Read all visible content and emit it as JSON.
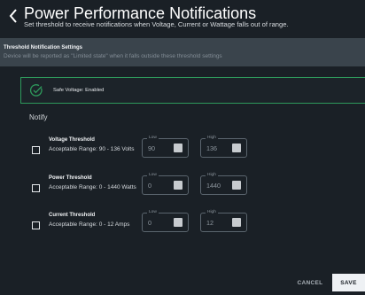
{
  "header": {
    "title": "Power Performance Notifications",
    "subtitle": "Set threshold to receive notifications when Voltage, Current or Wattage falls out of range."
  },
  "settings": {
    "title": "Threshold Notification Settings",
    "description": "Device will be reported as \"Limited state\" when it falls outside these threshold settings"
  },
  "safe_voltage": {
    "label": "Safe Voltage: Enabled",
    "status_color": "#2e9a5c"
  },
  "notify_label": "Notify",
  "thresholds": [
    {
      "title": "Voltage Threshold",
      "range": "Acceptable Range: 90 - 136 Volts",
      "low_label": "Low",
      "low_value": "90",
      "high_label": "High",
      "high_value": "136",
      "checked": false
    },
    {
      "title": "Power Threshold",
      "range": "Acceptable Range: 0 - 1440 Watts",
      "low_label": "Low",
      "low_value": "0",
      "high_label": "High",
      "high_value": "1440",
      "checked": false
    },
    {
      "title": "Current Threshold",
      "range": "Acceptable Range: 0 - 12 Amps",
      "low_label": "Low",
      "low_value": "0",
      "high_label": "High",
      "high_value": "12",
      "checked": false
    }
  ],
  "footer": {
    "cancel_label": "CANCEL",
    "save_label": "SAVE"
  },
  "icons": {
    "back": "chevron-left-icon",
    "safe": "check-circle-icon",
    "stepper": "stepper-icon"
  }
}
